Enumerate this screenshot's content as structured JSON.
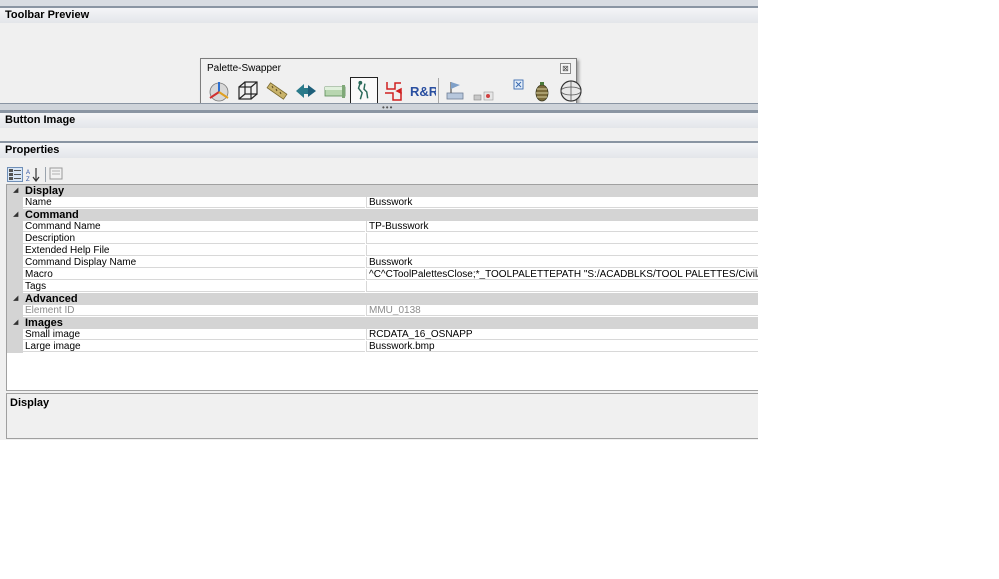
{
  "sections": {
    "toolbar_preview": "Toolbar Preview",
    "button_image": "Button Image",
    "properties": "Properties"
  },
  "palette": {
    "title": "Palette-Swapper",
    "close_glyph": "⊠",
    "buttons": [
      {
        "icon": "axis-tripod-icon"
      },
      {
        "icon": "wireframe-cube-icon"
      },
      {
        "icon": "ruler-icon"
      },
      {
        "icon": "arrow-swap-icon"
      },
      {
        "icon": "pipe-icon"
      },
      {
        "icon": "busswork-icon",
        "active": true
      },
      {
        "icon": "red-circuit-icon"
      },
      {
        "icon": "rnr-text-icon",
        "text": "R&R"
      },
      {
        "icon": "flag-folder-icon"
      },
      {
        "icon": "dim-tool-icon"
      },
      {
        "icon": "small-square-icon"
      },
      {
        "icon": "pinecone-icon"
      },
      {
        "icon": "globe-icon"
      }
    ]
  },
  "properties_toolbar": {
    "categorized_icon": "categorized-icon",
    "alphabetical_icon": "alphabetical-sort-icon",
    "pages_icon": "property-pages-icon"
  },
  "grid": {
    "categories": {
      "display": "Display",
      "command": "Command",
      "advanced": "Advanced",
      "images": "Images"
    },
    "rows": {
      "name": {
        "key": "Name",
        "value": "Busswork"
      },
      "command_name": {
        "key": "Command Name",
        "value": "TP-Busswork"
      },
      "description": {
        "key": "Description",
        "value": ""
      },
      "extended_help": {
        "key": "Extended Help File",
        "value": ""
      },
      "command_display_name": {
        "key": "Command Display Name",
        "value": "Busswork"
      },
      "macro": {
        "key": "Macro",
        "value": "^C^CToolPalettesClose;*_TOOLPALETTEPATH \"S:/ACADBLKS/TOOL PALETTES/Civil/Bus\";ToolPalettes"
      },
      "tags": {
        "key": "Tags",
        "value": ""
      },
      "element_id": {
        "key": "Element ID",
        "value": "MMU_0138"
      },
      "small_image": {
        "key": "Small image",
        "value": "RCDATA_16_OSNAPP"
      },
      "large_image": {
        "key": "Large image",
        "value": "Busswork.bmp"
      }
    }
  },
  "description_pane": {
    "title": "Display"
  },
  "colors": {
    "panel_bg": "#f0f0f0",
    "category_bg": "#d4d4d4",
    "header_border": "#8a95a3",
    "active_button_border": "#222222"
  }
}
